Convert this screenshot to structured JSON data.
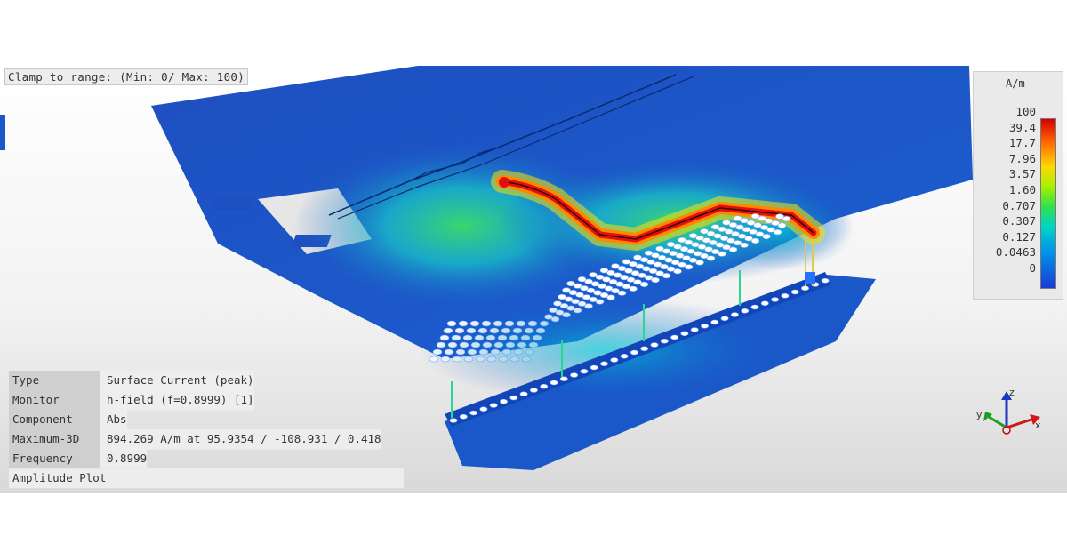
{
  "clamp_label": "Clamp to range: (Min: 0/ Max: 100)",
  "legend": {
    "unit": "A/m",
    "ticks": [
      "100",
      "39.4",
      "17.7",
      "7.96",
      "3.57",
      "1.60",
      "0.707",
      "0.307",
      "0.127",
      "0.0463",
      "0"
    ]
  },
  "info": {
    "rows": [
      {
        "key": "Type",
        "value": "Surface Current (peak)"
      },
      {
        "key": "Monitor",
        "value": "h-field (f=0.8999) [1]"
      },
      {
        "key": "Component",
        "value": "Abs"
      },
      {
        "key": "Maximum-3D",
        "value": "894.269 A/m at 95.9354 / -108.931 / 0.418"
      },
      {
        "key": "Frequency",
        "value": "0.8999"
      }
    ],
    "footer": "Amplitude Plot"
  },
  "axes": {
    "x": "x",
    "y": "y",
    "z": "z"
  },
  "colors": {
    "board": "#1a57c8",
    "hot": "#e01010",
    "warm": "#ffd400",
    "cool": "#20d080"
  }
}
